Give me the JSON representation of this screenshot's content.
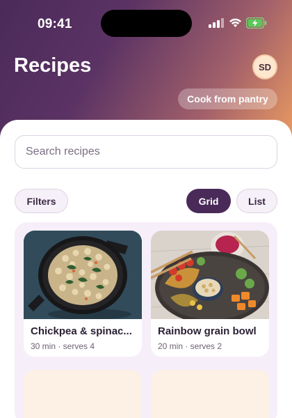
{
  "status_bar": {
    "time": "09:41"
  },
  "header": {
    "title": "Recipes",
    "avatar_initials": "SD",
    "pantry_button_label": "Cook from pantry"
  },
  "search": {
    "placeholder": "Search recipes",
    "value": ""
  },
  "toolbar": {
    "filters_label": "Filters",
    "view_options": [
      {
        "label": "Grid",
        "selected": true
      },
      {
        "label": "List",
        "selected": false
      }
    ]
  },
  "recipes": [
    {
      "title": "Chickpea & spinac...",
      "meta": "30 min · serves 4"
    },
    {
      "title": "Rainbow grain bowl",
      "meta": "20 min · serves 2"
    }
  ],
  "colors": {
    "accent": "#4a2a59",
    "gradient_start": "#4a2a59",
    "gradient_end": "#f1a060",
    "panel": "#f6eef8",
    "placeholder": "#fdf1e6"
  },
  "icons": [
    "signal-icon",
    "wifi-icon",
    "battery-charging-icon"
  ]
}
